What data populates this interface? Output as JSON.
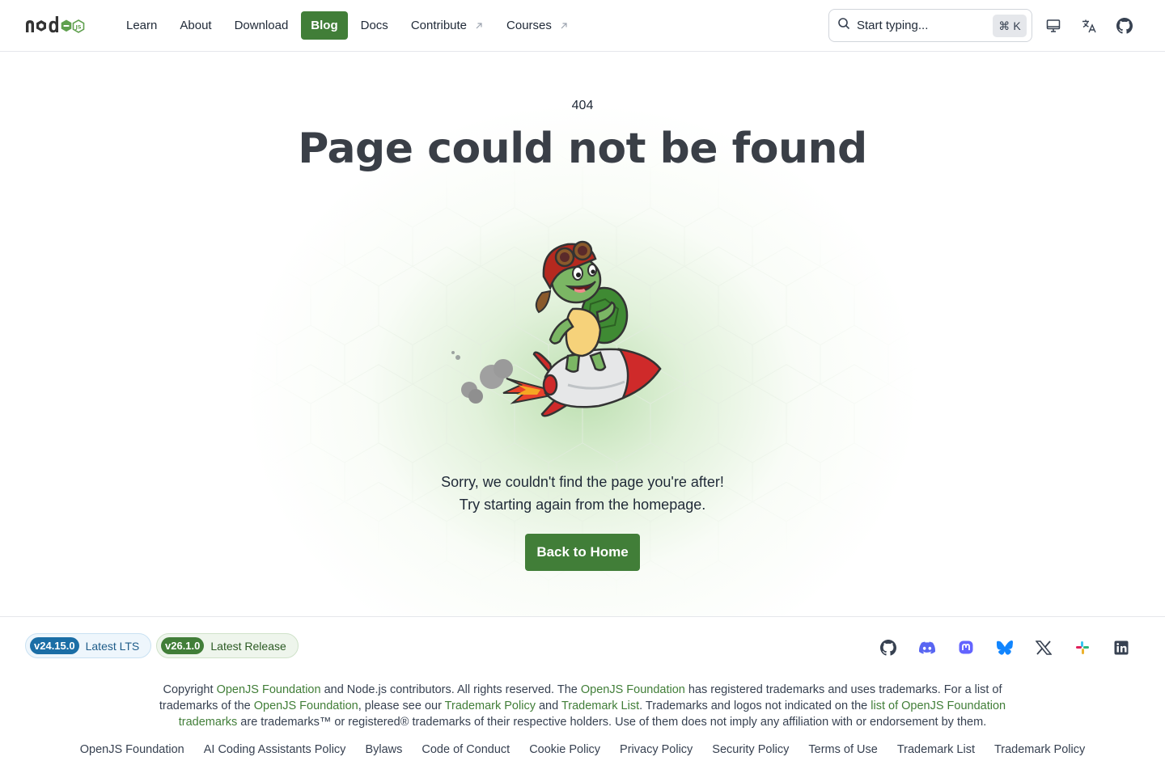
{
  "header": {
    "logo_text": "node",
    "logo_badge": "JS",
    "nav": [
      {
        "label": "Learn",
        "external": false,
        "active": false
      },
      {
        "label": "About",
        "external": false,
        "active": false
      },
      {
        "label": "Download",
        "external": false,
        "active": false
      },
      {
        "label": "Blog",
        "external": false,
        "active": true
      },
      {
        "label": "Docs",
        "external": false,
        "active": false
      },
      {
        "label": "Contribute",
        "external": true,
        "active": false
      },
      {
        "label": "Courses",
        "external": true,
        "active": false
      }
    ],
    "search": {
      "placeholder": "Start typing...",
      "shortcut_symbol": "⌘",
      "shortcut_key": "K"
    },
    "icons": [
      "theme-monitor-icon",
      "language-icon",
      "github-icon"
    ]
  },
  "main": {
    "code": "404",
    "title": "Page could not be found",
    "message_line1": "Sorry, we couldn't find the page you're after!",
    "message_line2": "Try starting again from the homepage.",
    "button_label": "Back to Home",
    "illustration": "turtle-on-rocket"
  },
  "footer": {
    "lts_version": "v24.15.0",
    "lts_label": "Latest LTS",
    "current_version": "v26.1.0",
    "current_label": "Latest Release",
    "socials": [
      "github-icon",
      "discord-icon",
      "mastodon-icon",
      "bluesky-icon",
      "x-icon",
      "slack-icon",
      "linkedin-icon"
    ],
    "legal": {
      "t1": "Copyright ",
      "l1": "OpenJS Foundation",
      "t2": " and Node.js contributors. All rights reserved. The ",
      "l2": "OpenJS Foundation",
      "t3": " has registered trademarks and uses trademarks. For a list of trademarks of the ",
      "l3": "OpenJS Foundation",
      "t4": ", please see our ",
      "l4": "Trademark Policy",
      "t5": " and ",
      "l5": "Trademark List",
      "t6": ". Trademarks and logos not indicated on the ",
      "l6": "list of OpenJS Foundation trademarks",
      "t7": " are trademarks™ or registered® trademarks of their respective holders. Use of them does not imply any affiliation with or endorsement by them."
    },
    "links": [
      "OpenJS Foundation",
      "AI Coding Assistants Policy",
      "Bylaws",
      "Code of Conduct",
      "Cookie Policy",
      "Privacy Policy",
      "Security Policy",
      "Terms of Use",
      "Trademark List",
      "Trademark Policy"
    ]
  },
  "colors": {
    "brand_green": "#417e38",
    "lts_blue": "#1b6ea6",
    "text": "#1f2937"
  }
}
